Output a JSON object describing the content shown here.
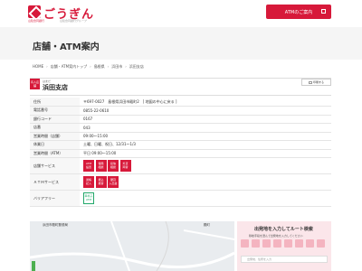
{
  "header": {
    "logo_text": "ごうぎん",
    "logo_sub": "山陰合同銀行",
    "logo_tag": "山陰合同銀行グループ",
    "atm_button": "ATMのご案内"
  },
  "page_title": "店舗・ATM案内",
  "breadcrumb": [
    "HOME",
    "店舗・ATM案内トップ",
    "島根県",
    "浜田市",
    "浜田支店"
  ],
  "branch": {
    "badge": "有人店舗",
    "kana": "はまだ",
    "name": "浜田支店",
    "print_label": "印刷する"
  },
  "info": {
    "address_label": "住所",
    "address": "〒697-0027　島根県浜田市殿町2　[ 地図の中心に戻る ]",
    "phone_label": "電話番号",
    "phone": "0855-22-0610",
    "code_label": "銀行コード",
    "code": "0167",
    "branch_no_label": "店番",
    "branch_no": "043",
    "hours_label": "営業時間（店舗）",
    "hours": "09:00～15:00",
    "holiday_label": "休業日",
    "holiday": "土曜、日曜、祝日、12/31～1/3",
    "atm_hours_label": "営業時間（ATM）",
    "atm_hours": "平日 09:00～15:00",
    "store_service_label": "店舗サービス",
    "store_services": [
      "ATM\n設置",
      "保険\n相談",
      "投信\n相談",
      "外貨\n両替"
    ],
    "atm_service_label": "ＡＴＭサービス",
    "atm_services": [
      "通帳\n記入",
      "振込\n振替",
      "硬貨\n入出金"
    ],
    "barrier_free_label": "バリアフリー",
    "barrier_free": [
      "車椅子\nATM"
    ]
  },
  "map": {
    "label1": "浜田市殿町郵便局",
    "label2": "殿町"
  },
  "route": {
    "title": "出発地を入力してルート検索",
    "note": "移動手段を選んで出発地を入力してください",
    "input_placeholder": "出発地、住所を入力"
  }
}
